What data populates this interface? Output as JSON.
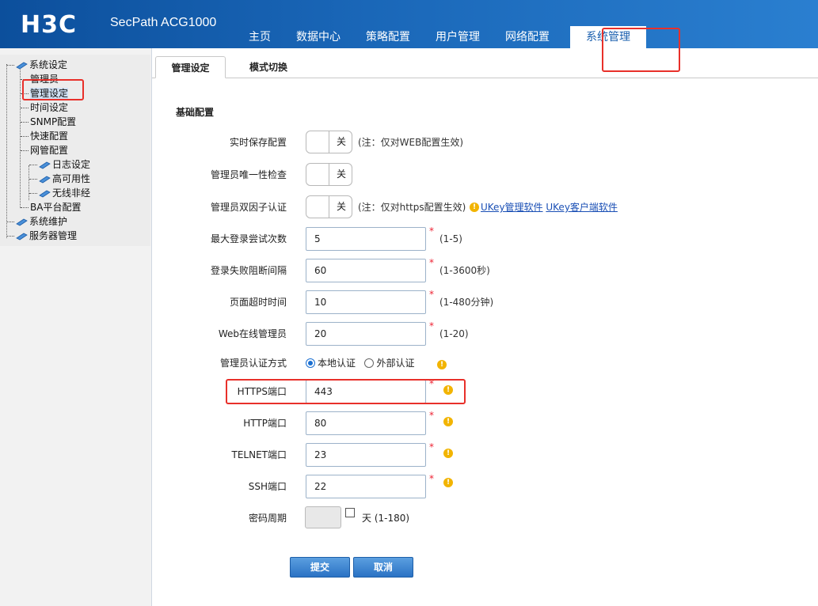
{
  "header": {
    "logo_text": "H3C",
    "product": "SecPath ACG1000",
    "nav": [
      "主页",
      "数据中心",
      "策略配置",
      "用户管理",
      "网络配置",
      "系统管理"
    ],
    "active_nav": "系统管理"
  },
  "sidebar": {
    "tree": [
      {
        "label": "系统设定",
        "level": 0,
        "folder": true
      },
      {
        "label": "管理员",
        "level": 1
      },
      {
        "label": "管理设定",
        "level": 1,
        "selected": true
      },
      {
        "label": "时间设定",
        "level": 1
      },
      {
        "label": "SNMP配置",
        "level": 1
      },
      {
        "label": "快速配置",
        "level": 1
      },
      {
        "label": "网管配置",
        "level": 1
      },
      {
        "label": "日志设定",
        "level": 2,
        "folder": true
      },
      {
        "label": "高可用性",
        "level": 2,
        "folder": true
      },
      {
        "label": "无线非经",
        "level": 2,
        "folder": true
      },
      {
        "label": "BA平台配置",
        "level": 1
      },
      {
        "label": "系统维护",
        "level": 0,
        "folder": true
      },
      {
        "label": "服务器管理",
        "level": 0,
        "folder": true
      }
    ]
  },
  "tabs": [
    "管理设定",
    "模式切换"
  ],
  "section_title": "基础配置",
  "form": {
    "realtime_save": {
      "label": "实时保存配置",
      "state": "关",
      "note": "(注：仅对WEB配置生效)"
    },
    "unique_check": {
      "label": "管理员唯一性检查",
      "state": "关"
    },
    "two_factor": {
      "label": "管理员双因子认证",
      "state": "关",
      "note": "(注：仅对https配置生效)",
      "link1": "UKey管理软件",
      "link2": "UKey客户端软件"
    },
    "max_login": {
      "label": "最大登录尝试次数",
      "value": "5",
      "hint": "(1-5)"
    },
    "block_interval": {
      "label": "登录失败阻断间隔",
      "value": "60",
      "hint": "(1-3600秒)"
    },
    "timeout": {
      "label": "页面超时时间",
      "value": "10",
      "hint": "(1-480分钟)"
    },
    "web_admins": {
      "label": "Web在线管理员",
      "value": "20",
      "hint": "(1-20)"
    },
    "auth_method": {
      "label": "管理员认证方式",
      "option1": "本地认证",
      "option2": "外部认证",
      "selected": "本地认证"
    },
    "https_port": {
      "label": "HTTPS端口",
      "value": "443"
    },
    "http_port": {
      "label": "HTTP端口",
      "value": "80"
    },
    "telnet_port": {
      "label": "TELNET端口",
      "value": "23"
    },
    "ssh_port": {
      "label": "SSH端口",
      "value": "22"
    },
    "pwd_period": {
      "label": "密码周期",
      "unit": "天",
      "hint": "(1-180)",
      "checked": false
    },
    "required_mark": "*"
  },
  "buttons": {
    "submit": "提交",
    "cancel": "取消"
  },
  "colors": {
    "header": "#1a67b8",
    "highlight": "#e8302a",
    "button": "#2a72c4",
    "warn": "#f2b400"
  }
}
